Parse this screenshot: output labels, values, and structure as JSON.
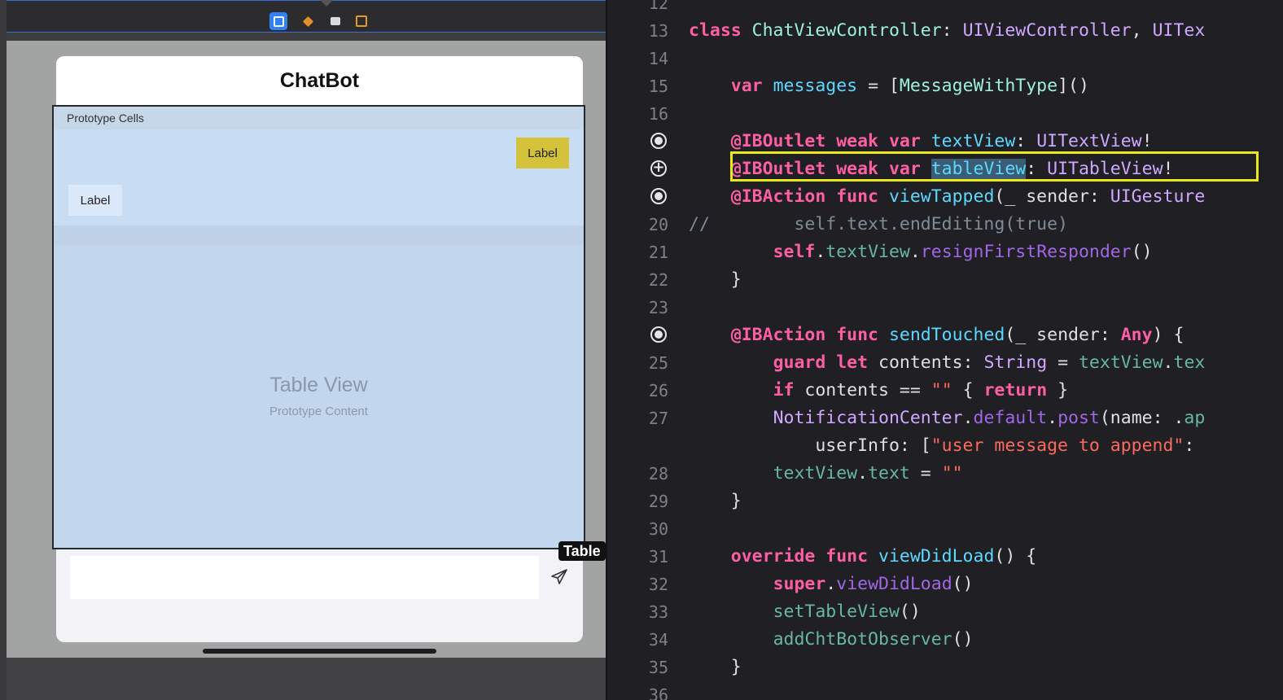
{
  "storyboard": {
    "nav_title": "ChatBot",
    "table_header": "Prototype Cells",
    "cell_label_right": "Label",
    "cell_label_left": "Label",
    "table_title": "Table View",
    "table_subtitle": "Prototype Content",
    "tooltip": "Table",
    "scene_icons": [
      "view-controller-icon",
      "first-responder-icon",
      "storyboard-object-icon",
      "exit-icon"
    ],
    "colors": {
      "selection_blue": "#2f82f5",
      "label_yellow": "#d4c33a",
      "table_bg": "#c2d6ee"
    }
  },
  "editor": {
    "highlight_color": "#e8e81c",
    "lines": [
      {
        "num": "12",
        "tokens": []
      },
      {
        "num": "13",
        "tokens": [
          [
            "kw",
            "class "
          ],
          [
            "cls",
            "ChatViewController"
          ],
          [
            "pl",
            ": "
          ],
          [
            "ty",
            "UIViewController"
          ],
          [
            "pl",
            ", "
          ],
          [
            "ty",
            "UITex"
          ]
        ]
      },
      {
        "num": "14",
        "tokens": []
      },
      {
        "num": "15",
        "tokens": [
          [
            "pl",
            "    "
          ],
          [
            "kw",
            "var "
          ],
          [
            "pt",
            "messages"
          ],
          [
            "pl",
            " = ["
          ],
          [
            "cls",
            "MessageWithType"
          ],
          [
            "pl",
            "]()"
          ]
        ]
      },
      {
        "num": "16",
        "tokens": []
      },
      {
        "num": "",
        "gutter": "filled",
        "tokens": [
          [
            "pl",
            "    "
          ],
          [
            "kw",
            "@IBOutlet weak var "
          ],
          [
            "pt",
            "textView"
          ],
          [
            "pl",
            ": "
          ],
          [
            "ty",
            "UITextView"
          ],
          [
            "pl",
            "!"
          ]
        ]
      },
      {
        "num": "",
        "gutter": "plus",
        "tokens": [
          [
            "pl",
            "    "
          ],
          [
            "kw",
            "@IBOutlet weak var "
          ],
          [
            "hl",
            "tableView"
          ],
          [
            "pl",
            ": "
          ],
          [
            "ty",
            "UITableView"
          ],
          [
            "pl",
            "!"
          ]
        ]
      },
      {
        "num": "",
        "gutter": "filled",
        "tokens": [
          [
            "pl",
            "    "
          ],
          [
            "kw",
            "@IBAction func "
          ],
          [
            "pt",
            "viewTapped"
          ],
          [
            "pl",
            "(_ sender: "
          ],
          [
            "ty",
            "UIGesture"
          ]
        ]
      },
      {
        "num": "20",
        "tokens": [
          [
            "cm",
            "//        self.text.endEditing(true)"
          ]
        ]
      },
      {
        "num": "21",
        "tokens": [
          [
            "pl",
            "        "
          ],
          [
            "kw",
            "self"
          ],
          [
            "pl",
            "."
          ],
          [
            "fn",
            "textView"
          ],
          [
            "pl",
            "."
          ],
          [
            "mt",
            "resignFirstResponder"
          ],
          [
            "pl",
            "()"
          ]
        ]
      },
      {
        "num": "22",
        "tokens": [
          [
            "pl",
            "    }"
          ]
        ]
      },
      {
        "num": "23",
        "tokens": []
      },
      {
        "num": "",
        "gutter": "filled",
        "tokens": [
          [
            "pl",
            "    "
          ],
          [
            "kw",
            "@IBAction func "
          ],
          [
            "pt",
            "sendTouched"
          ],
          [
            "pl",
            "(_ sender: "
          ],
          [
            "kw",
            "Any"
          ],
          [
            "pl",
            ") {"
          ]
        ]
      },
      {
        "num": "25",
        "tokens": [
          [
            "pl",
            "        "
          ],
          [
            "kw",
            "guard let "
          ],
          [
            "pl",
            "contents: "
          ],
          [
            "ty",
            "String"
          ],
          [
            "pl",
            " = "
          ],
          [
            "fn",
            "textView"
          ],
          [
            "pl",
            "."
          ],
          [
            "fn",
            "tex"
          ]
        ]
      },
      {
        "num": "26",
        "tokens": [
          [
            "pl",
            "        "
          ],
          [
            "kw",
            "if "
          ],
          [
            "pl",
            "contents == "
          ],
          [
            "st",
            "\"\""
          ],
          [
            "pl",
            " { "
          ],
          [
            "kw",
            "return"
          ],
          [
            "pl",
            " }"
          ]
        ]
      },
      {
        "num": "27",
        "tokens": [
          [
            "pl",
            "        "
          ],
          [
            "ty",
            "NotificationCenter"
          ],
          [
            "pl",
            "."
          ],
          [
            "mt",
            "default"
          ],
          [
            "pl",
            "."
          ],
          [
            "mt",
            "post"
          ],
          [
            "pl",
            "(name: ."
          ],
          [
            "fn",
            "ap"
          ]
        ]
      },
      {
        "num": "",
        "tokens": [
          [
            "pl",
            "            userInfo: ["
          ],
          [
            "st",
            "\"user message to append\""
          ],
          [
            "pl",
            ":"
          ]
        ]
      },
      {
        "num": "28",
        "tokens": [
          [
            "pl",
            "        "
          ],
          [
            "fn",
            "textView"
          ],
          [
            "pl",
            "."
          ],
          [
            "fn",
            "text"
          ],
          [
            "pl",
            " = "
          ],
          [
            "st",
            "\"\""
          ]
        ]
      },
      {
        "num": "29",
        "tokens": [
          [
            "pl",
            "    }"
          ]
        ]
      },
      {
        "num": "30",
        "tokens": []
      },
      {
        "num": "31",
        "tokens": [
          [
            "pl",
            "    "
          ],
          [
            "kw",
            "override func "
          ],
          [
            "pt",
            "viewDidLoad"
          ],
          [
            "pl",
            "() {"
          ]
        ]
      },
      {
        "num": "32",
        "tokens": [
          [
            "pl",
            "        "
          ],
          [
            "kw",
            "super"
          ],
          [
            "pl",
            "."
          ],
          [
            "mt",
            "viewDidLoad"
          ],
          [
            "pl",
            "()"
          ]
        ]
      },
      {
        "num": "33",
        "tokens": [
          [
            "pl",
            "        "
          ],
          [
            "fn",
            "setTableView"
          ],
          [
            "pl",
            "()"
          ]
        ]
      },
      {
        "num": "34",
        "tokens": [
          [
            "pl",
            "        "
          ],
          [
            "fn",
            "addChtBotObserver"
          ],
          [
            "pl",
            "()"
          ]
        ]
      },
      {
        "num": "35",
        "tokens": [
          [
            "pl",
            "    }"
          ]
        ]
      },
      {
        "num": "36",
        "tokens": []
      }
    ]
  }
}
